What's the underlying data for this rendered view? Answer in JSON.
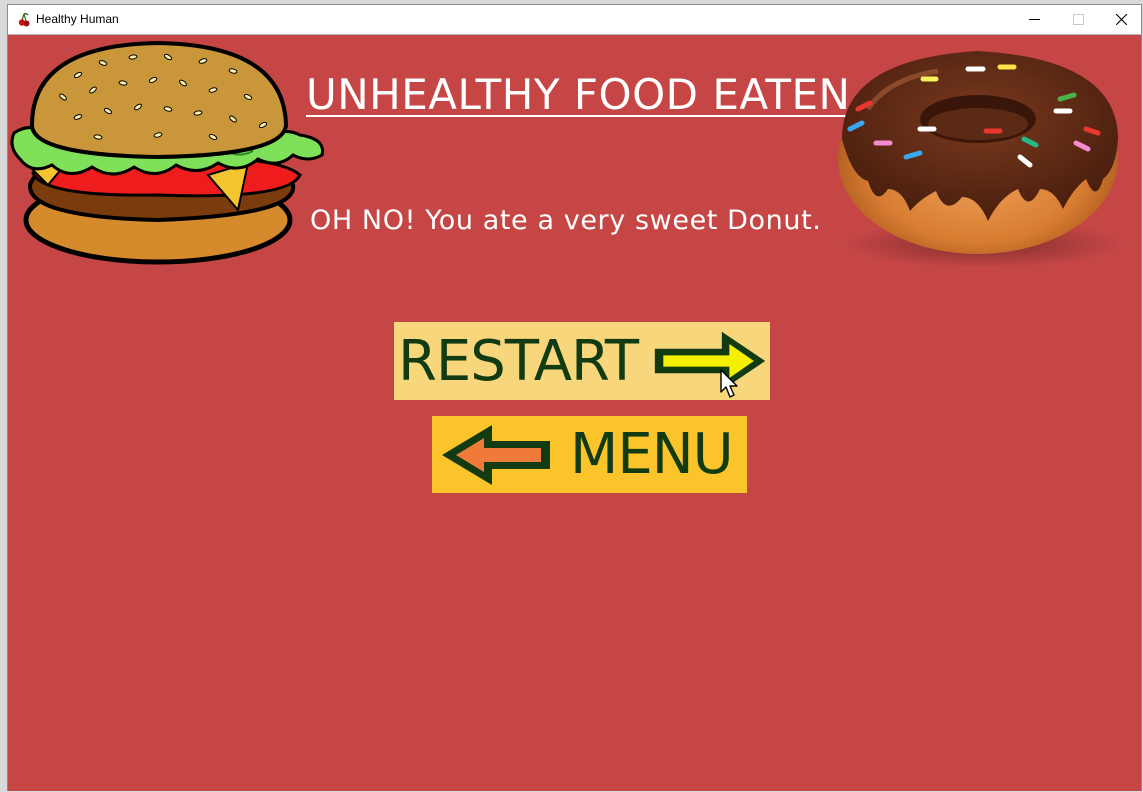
{
  "window": {
    "title": "Healthy Human",
    "controls": {
      "minimize_icon": "minimize-icon",
      "maximize_icon": "maximize-icon",
      "close_icon": "close-icon"
    }
  },
  "screen": {
    "heading": "UNHEALTHY FOOD EATEN",
    "message": "OH NO! You ate a very sweet Donut.",
    "restart_label": "RESTART",
    "menu_label": "MENU"
  },
  "colors": {
    "background": "#c54645",
    "restart_button": "#f8d77c",
    "menu_button": "#fbc42a",
    "button_text": "#123b12",
    "restart_arrow": "#f5f000",
    "menu_arrow": "#f07a3a"
  },
  "icons": {
    "left_image": "burger-illustration",
    "right_image": "donut-illustration",
    "restart_arrow": "arrow-right-icon",
    "menu_arrow": "arrow-left-icon"
  }
}
